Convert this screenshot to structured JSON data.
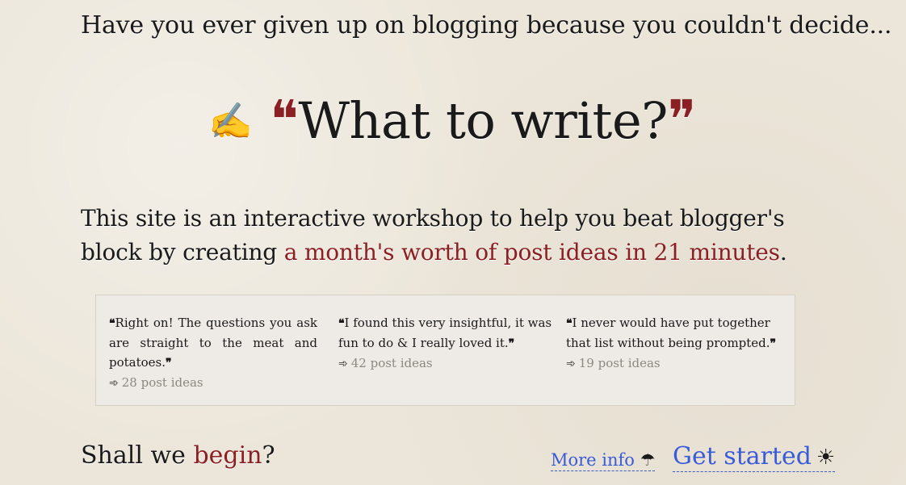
{
  "intro": "Have you ever given up on blogging because you couldn't decide...",
  "headline": {
    "pen_icon": "✍",
    "open_quote": "❝",
    "text": "What to write?",
    "close_quote": "❞"
  },
  "lede": {
    "part1": "This site is an interactive workshop to help you beat blogger's block by creating ",
    "highlight": "a month's worth of post ideas in 21 minutes",
    "part2": "."
  },
  "testimonials": [
    {
      "open_quote": "❝",
      "quote": "Right on! The questions you ask are straight to the meat and potatoes.",
      "close_quote": "❞",
      "arrow": "➾",
      "result": "28 post ideas"
    },
    {
      "open_quote": "❝",
      "quote": "I found this very insightful, it was fun to do & I really loved it.",
      "close_quote": "❞",
      "arrow": "➾",
      "result": "42 post ideas"
    },
    {
      "open_quote": "❝",
      "quote": "I never would have put together that list without being prompted.",
      "close_quote": "❞",
      "arrow": "➾",
      "result": "19 post ideas"
    }
  ],
  "cta": {
    "prefix": "Shall we ",
    "highlight": "begin",
    "suffix": "?",
    "more_info_label": "More info",
    "more_info_icon": "☂",
    "get_started_label": "Get started",
    "get_started_icon": "☀"
  },
  "colors": {
    "accent": "#8a1f24",
    "link": "#3a5bd8",
    "background": "#ece6da"
  }
}
